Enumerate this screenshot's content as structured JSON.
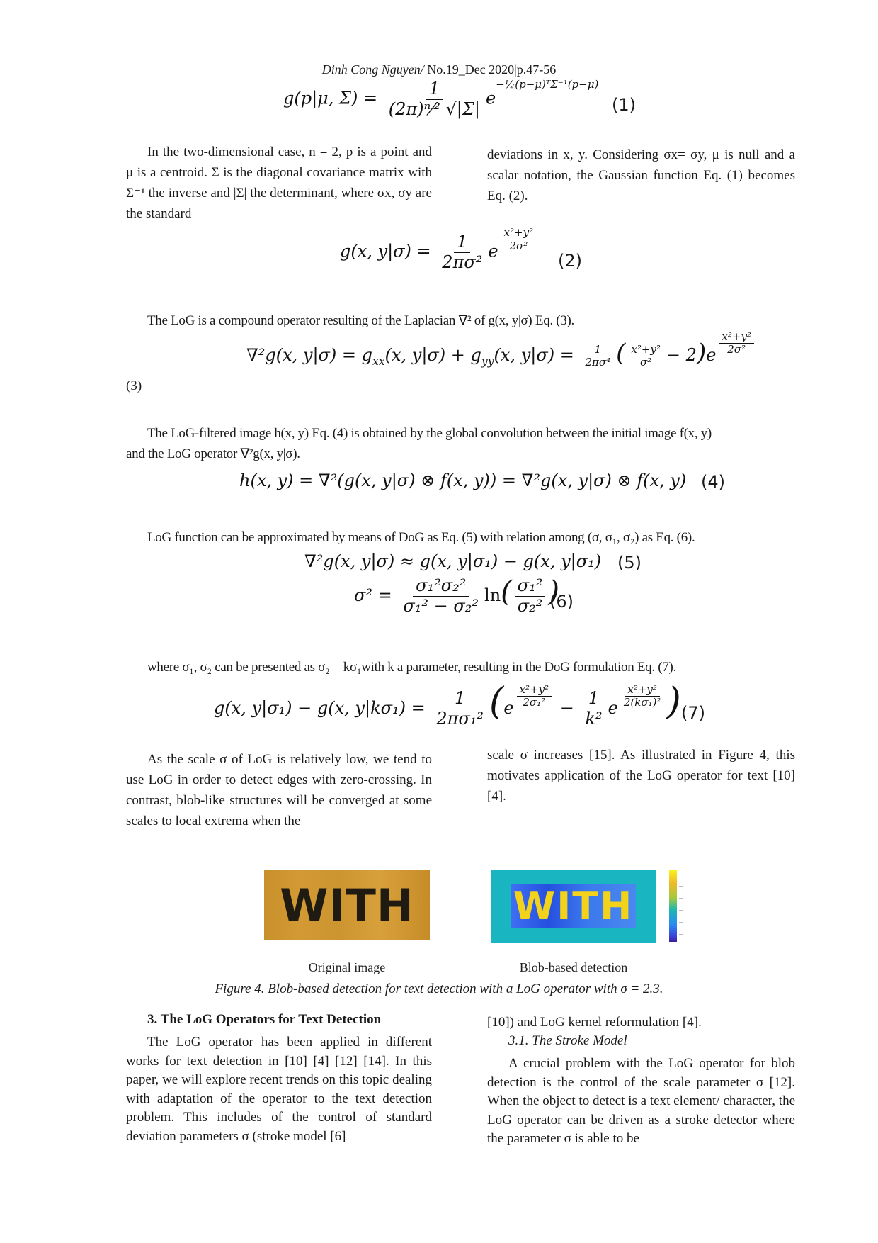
{
  "header": {
    "author": "Dinh Cong Nguyen/",
    "journal": " No.19_Dec 2020|p.47-56"
  },
  "equations": {
    "eq1": {
      "lhs": "g(p|μ, Σ) =",
      "num": "1",
      "den": "(2π)ⁿ⁄² √|Σ|",
      "exp": "−½(p−μ)ᵀΣ⁻¹(p−μ)",
      "base": "e",
      "number": "(1)"
    },
    "eq2": {
      "lhs": "g(x, y|σ) =",
      "num": "1",
      "den": "2πσ²",
      "base": "e",
      "exp_num": "x²+y²",
      "exp_den": "2σ²",
      "number": "(2)"
    },
    "eq3": {
      "lhs": "∇²g(x, y|σ) =  g",
      "lhs_sub1": "xx",
      "mid1": "(x, y|σ) +  g",
      "lhs_sub2": "yy",
      "mid2": "(x, y|σ) =",
      "num": "1",
      "den": "2πσ⁴",
      "paren_num": "x²+y²",
      "paren_den": "σ²",
      "paren_tail": "− 2",
      "base": "e",
      "exp_num": "x²+y²",
      "exp_den": "2σ²",
      "number": "(3)"
    },
    "eq4": {
      "text": "h(x, y) =  ∇²(g(x, y|σ) ⊗ f(x, y)) = ∇²g(x, y|σ) ⊗ f(x, y)",
      "number": "(4)"
    },
    "eq5": {
      "text": "∇²g(x, y|σ)  ≈   g(x, y|σ₁) −  g(x, y|σ₁)",
      "number": "(5)"
    },
    "eq6": {
      "lhs": "σ² =",
      "num": "σ₁²σ₂²",
      "den": "σ₁² −  σ₂²",
      "ln": "ln",
      "inner_num": "σ₁²",
      "inner_den": "σ₂²",
      "number": "(6)"
    },
    "eq7": {
      "lhs": "g(x, y|σ₁) −  g(x, y|kσ₁) =",
      "num": "1",
      "den": "2πσ₁²",
      "base": "e",
      "exp1_num": "x²+y²",
      "exp1_den": "2σ₁²",
      "minus": "−",
      "k_num": "1",
      "k_den": "k²",
      "exp2_num": "x²+y²",
      "exp2_den": "2(kσ₁)²",
      "number": "(7)"
    }
  },
  "paragraphs": {
    "p1_left": "In the two-dimensional case, n = 2, p is a point and μ is a centroid. Σ is the diagonal covariance matrix with Σ⁻¹ the inverse and |Σ| the determinant, where σx, σy are the standard",
    "p1_right": "deviations in x, y. Considering σx= σy, μ is null and a scalar notation, the Gaussian function Eq. (1) becomes Eq. (2).",
    "p2": "The LoG is a compound operator resulting of the Laplacian ∇² of g(x, y|σ) Eq. (3).",
    "p3_line1": "The LoG-filtered image h(x, y) Eq. (4) is obtained by the global convolution between the initial image f(x, y)",
    "p3_line2": "and the LoG operator ∇²g(x, y|σ).",
    "p4": "LoG function can be approximated by means of DoG as Eq. (5) with relation among (σ, σ₁, σ₂) as Eq. (6).",
    "p5": "where σ₁, σ₂ can be presented as σ₂ = kσ₁with k a parameter, resulting in the DoG formulation Eq. (7).",
    "p6_left": "As the scale σ of LoG is relatively low, we tend to use LoG in order to detect edges with zero-crossing. In contrast, blob-like structures will be converged at some scales to local extrema when the",
    "p6_right": "scale σ increases [15]. As illustrated in Figure 4, this motivates application of the LoG operator for text [10] [4]."
  },
  "figure": {
    "original_label": "Original image",
    "blob_label": "Blob-based detection",
    "original_word": "WITH",
    "blob_word": "WITH",
    "caption": "Figure 4. Blob-based detection for text detection with a LoG operator with σ = 2.3.",
    "colorbar_colors": [
      "#f9f21a",
      "#f0b92c",
      "#a6c93a",
      "#1fb7b0",
      "#2a8df0",
      "#3a44d8",
      "#3b1f9a"
    ]
  },
  "section3": {
    "heading": "3. The LoG Operators for Text Detection",
    "left_text": "The LoG operator has been applied in different works for text detection in [10] [4] [12] [14]. In this paper, we will explore recent trends on this topic dealing with adaptation of the operator to the text detection problem. This includes of the control of standard deviation parameters σ (stroke model [6]",
    "right_first": "[10]) and LoG kernel reformulation [4].",
    "subheading": "3.1. The Stroke Model",
    "right_text": "A crucial problem with the LoG operator for blob detection is the control of the scale parameter σ [12]. When the object to detect is a text element/ character, the LoG operator can be driven as a stroke detector where the parameter σ is able to be"
  }
}
